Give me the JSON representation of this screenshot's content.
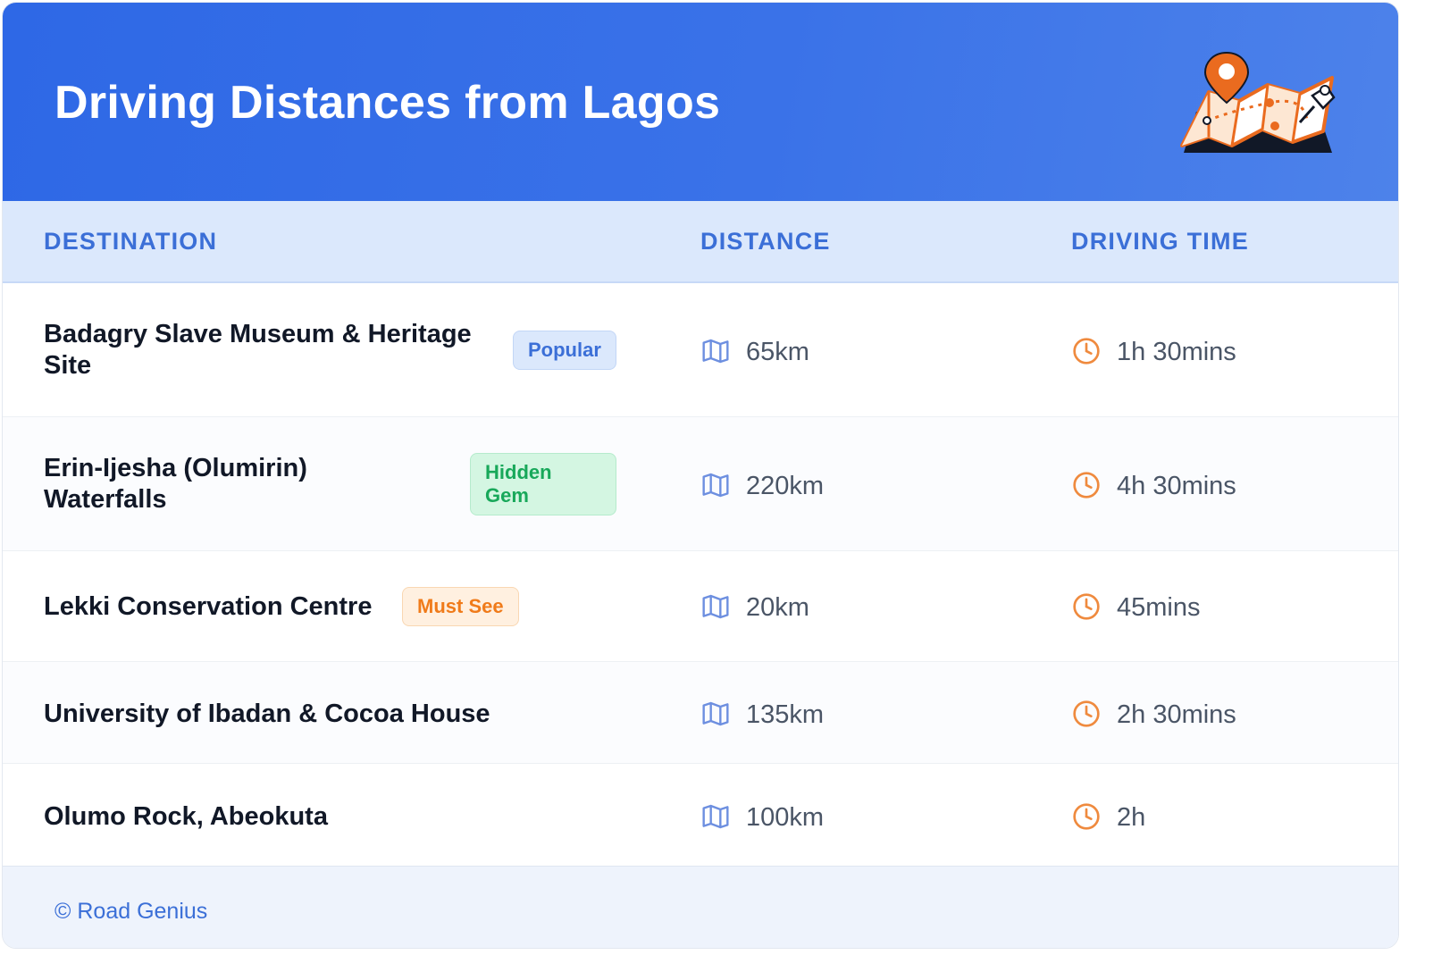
{
  "header": {
    "title": "Driving Distances from Lagos",
    "illustration_icon": "map-with-pins-icon"
  },
  "table": {
    "columns": [
      "DESTINATION",
      "DISTANCE",
      "DRIVING TIME"
    ],
    "rows": [
      {
        "destination_line1": "Badagry Slave Museum & Heritage",
        "destination_line2": "Site",
        "badge": "Popular",
        "badge_type": "popular",
        "distance": "65km",
        "driving_time": "1h 30mins"
      },
      {
        "destination_line1": "Erin-Ijesha (Olumirin)",
        "destination_line2": "Waterfalls",
        "badge_line1": "Hidden",
        "badge_line2": "Gem",
        "badge_type": "gem",
        "distance": "220km",
        "driving_time": "4h 30mins"
      },
      {
        "destination": "Lekki Conservation Centre",
        "badge": "Must See",
        "badge_type": "must",
        "distance": "20km",
        "driving_time": "45mins"
      },
      {
        "destination": "University of Ibadan & Cocoa House",
        "distance": "135km",
        "driving_time": "2h 30mins"
      },
      {
        "destination": "Olumo Rock, Abeokuta",
        "distance": "100km",
        "driving_time": "2h"
      }
    ]
  },
  "icons": {
    "distance": "map-icon",
    "time": "clock-icon"
  },
  "footer": {
    "text": "© Road Genius"
  },
  "colors": {
    "header_blue": "#2e68e6",
    "accent_blue": "#3b6fd7",
    "orange": "#f07b1a",
    "green": "#18a85a"
  }
}
